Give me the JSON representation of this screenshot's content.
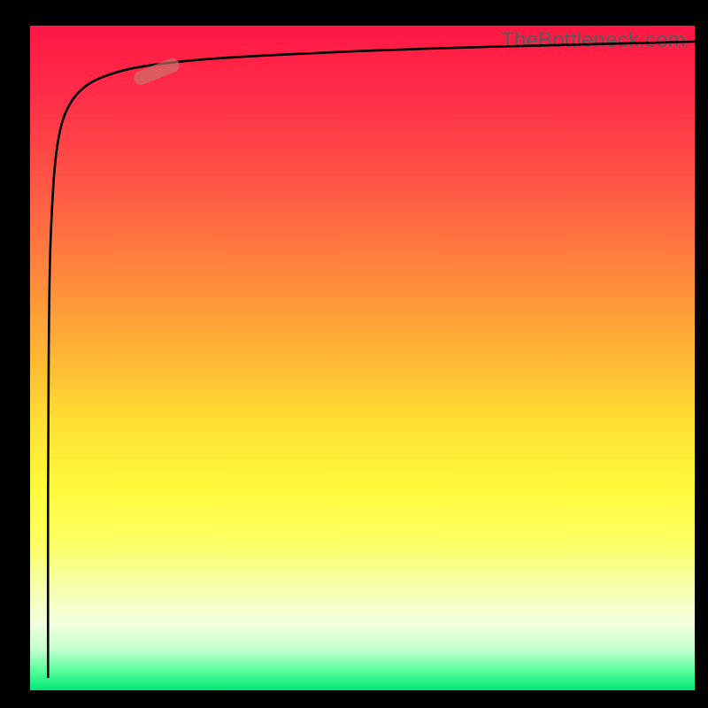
{
  "watermark": "TheBottleneck.com",
  "colors": {
    "frame": "#000000",
    "curve": "#000000",
    "marker": "rgba(200,120,110,0.65)",
    "gradient_stops": [
      {
        "pos": 0,
        "hex": "#ff1744"
      },
      {
        "pos": 10,
        "hex": "#ff2c48"
      },
      {
        "pos": 25,
        "hex": "#ff5a45"
      },
      {
        "pos": 38,
        "hex": "#ff8a3c"
      },
      {
        "pos": 50,
        "hex": "#ffb734"
      },
      {
        "pos": 60,
        "hex": "#ffe132"
      },
      {
        "pos": 70,
        "hex": "#fffb3a"
      },
      {
        "pos": 78,
        "hex": "#fcff65"
      },
      {
        "pos": 84,
        "hex": "#f7ffa8"
      },
      {
        "pos": 90,
        "hex": "#f2ffe0"
      },
      {
        "pos": 94,
        "hex": "#bfffcc"
      },
      {
        "pos": 97,
        "hex": "#5aff9c"
      },
      {
        "pos": 100,
        "hex": "#00e676"
      }
    ]
  },
  "chart_data": {
    "type": "line",
    "title": "",
    "xlabel": "",
    "ylabel": "",
    "xlim": [
      0,
      100
    ],
    "ylim": [
      0,
      100
    ],
    "grid": false,
    "legend": false,
    "series": [
      {
        "name": "bottleneck-curve",
        "x": [
          2.7,
          2.7,
          2.8,
          3.0,
          3.5,
          4.1,
          5.0,
          6.5,
          8.5,
          11.0,
          15.0,
          20.0,
          27.0,
          37.0,
          50.0,
          65.0,
          80.0,
          100.0
        ],
        "y": [
          2.0,
          30.0,
          50.0,
          65.0,
          76.0,
          82.0,
          86.0,
          89.0,
          91.0,
          92.3,
          93.5,
          94.3,
          95.0,
          95.6,
          96.2,
          96.7,
          97.1,
          97.6
        ]
      }
    ],
    "marker": {
      "x_center": 19.0,
      "y_center": 93.1,
      "angle_deg": -22
    },
    "background": "vertical red→orange→yellow→green gradient"
  }
}
